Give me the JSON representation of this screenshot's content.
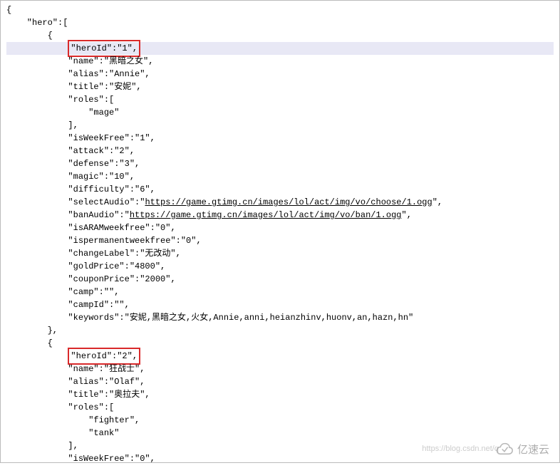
{
  "code": {
    "l0": "{",
    "l1": "    \"hero\":[",
    "l2": "        {",
    "l3_prefix": "            ",
    "l3_box": "\"heroId\":\"1\",",
    "l4": "            \"name\":\"黑暗之女\",",
    "l5": "            \"alias\":\"Annie\",",
    "l6": "            \"title\":\"安妮\",",
    "l7": "            \"roles\":[",
    "l8": "                \"mage\"",
    "l9": "            ],",
    "l10": "            \"isWeekFree\":\"1\",",
    "l11": "            \"attack\":\"2\",",
    "l12": "            \"defense\":\"3\",",
    "l13": "            \"magic\":\"10\",",
    "l14": "            \"difficulty\":\"6\",",
    "l15a": "            \"selectAudio\":\"",
    "l15b": "https://game.gtimg.cn/images/lol/act/img/vo/choose/1.ogg",
    "l15c": "\",",
    "l16a": "            \"banAudio\":\"",
    "l16b": "https://game.gtimg.cn/images/lol/act/img/vo/ban/1.ogg",
    "l16c": "\",",
    "l17": "            \"isARAMweekfree\":\"0\",",
    "l18": "            \"ispermanentweekfree\":\"0\",",
    "l19": "            \"changeLabel\":\"无改动\",",
    "l20": "            \"goldPrice\":\"4800\",",
    "l21": "            \"couponPrice\":\"2000\",",
    "l22": "            \"camp\":\"\",",
    "l23": "            \"campId\":\"\",",
    "l24": "            \"keywords\":\"安妮,黑暗之女,火女,Annie,anni,heianzhinv,huonv,an,hazn,hn\"",
    "l25": "        },",
    "l26": "        {",
    "l27_prefix": "            ",
    "l27_box": "\"heroId\":\"2\",",
    "l28": "            \"name\":\"狂战士\",",
    "l29": "            \"alias\":\"Olaf\",",
    "l30": "            \"title\":\"奥拉夫\",",
    "l31": "            \"roles\":[",
    "l32": "                \"fighter\",",
    "l33": "                \"tank\"",
    "l34": "            ],",
    "l35": "            \"isWeekFree\":\"0\","
  },
  "watermark": {
    "url": "https://blog.csdn.net/q",
    "brand": "亿速云"
  }
}
